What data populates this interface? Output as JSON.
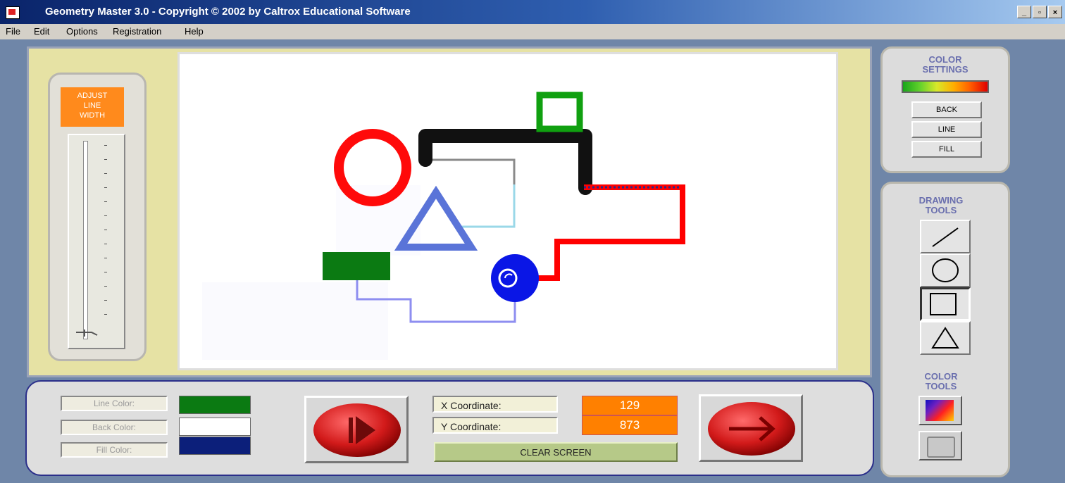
{
  "window": {
    "title": "Geometry Master 3.0 - Copyright © 2002 by Caltrox Educational Software",
    "buttons": [
      "_",
      "▫",
      "×"
    ]
  },
  "menu": [
    "File",
    "Edit",
    "Options",
    "Registration",
    "Help"
  ],
  "slider": {
    "label": "ADJUST\nLINE\nWIDTH"
  },
  "color_settings": {
    "heading": "COLOR\nSETTINGS",
    "buttons": [
      "BACK",
      "LINE",
      "FILL"
    ]
  },
  "drawing_tools": {
    "heading": "DRAWING\nTOOLS",
    "tools": [
      "line-tool",
      "circle-tool",
      "rectangle-tool",
      "triangle-tool"
    ],
    "active": "rectangle-tool"
  },
  "color_tools": {
    "heading": "COLOR\nTOOLS"
  },
  "colors": {
    "line": {
      "label": "Line Color:",
      "value": "#0b7a12"
    },
    "back": {
      "label": "Back Color:",
      "value": "#ffffff"
    },
    "fill": {
      "label": "Fill Color:",
      "value": "#0c1f7a"
    }
  },
  "coordinates": {
    "x_label": "X Coordinate:",
    "x_value": "129",
    "y_label": "Y Coordinate:",
    "y_value": "873"
  },
  "clear_button": "CLEAR SCREEN"
}
